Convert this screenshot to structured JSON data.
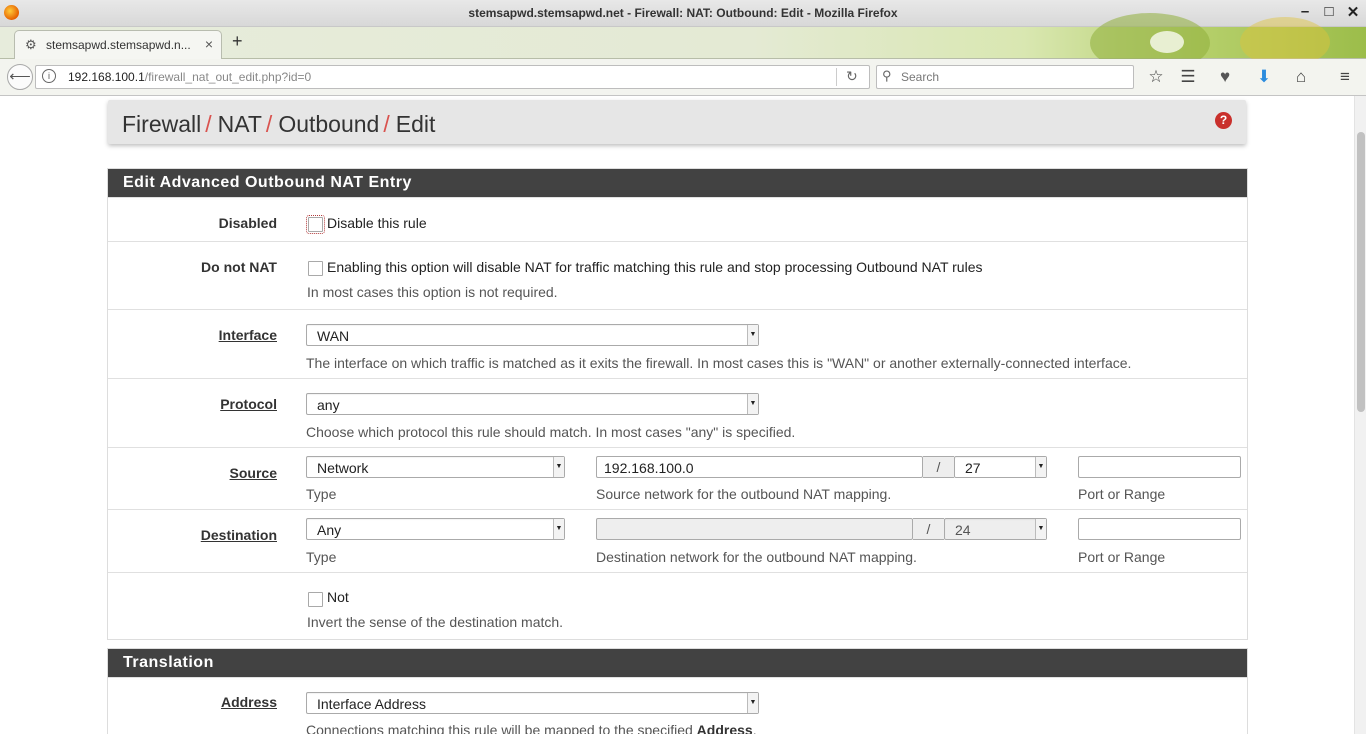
{
  "window": {
    "title": "stemsapwd.stemsapwd.net - Firewall: NAT: Outbound: Edit - Mozilla Firefox",
    "controls": {
      "minimize": "–",
      "maximize": "□",
      "close": "✕"
    }
  },
  "tabs": [
    {
      "label": "stemsapwd.stemsapwd.n...",
      "close": "×",
      "icon": "tab-favicon-icon"
    }
  ],
  "new_tab": "+",
  "nav": {
    "url_host": "192.168.100.1",
    "url_path": "/firewall_nat_out_edit.php?id=0",
    "search_placeholder": "Search",
    "icons": [
      "bookmark-star-icon",
      "reading-list-icon",
      "pocket-icon",
      "downloads-icon",
      "home-icon",
      "menu-icon"
    ]
  },
  "breadcrumb": {
    "items": [
      "Firewall",
      "NAT",
      "Outbound",
      "Edit"
    ],
    "separator": "/"
  },
  "panel1": {
    "title": "Edit Advanced Outbound NAT Entry",
    "disabled": {
      "label": "Disabled",
      "checkbox_label": "Disable this rule"
    },
    "donotnat": {
      "label": "Do not NAT",
      "checkbox_label": "Enabling this option will disable NAT for traffic matching this rule and stop processing Outbound NAT rules",
      "help": "In most cases this option is not required."
    },
    "interface": {
      "label": "Interface",
      "value": "WAN",
      "help": "The interface on which traffic is matched as it exits the firewall. In most cases this is \"WAN\" or another externally-connected interface."
    },
    "protocol": {
      "label": "Protocol",
      "value": "any",
      "help": "Choose which protocol this rule should match. In most cases \"any\" is specified."
    },
    "source": {
      "label": "Source",
      "type_value": "Network",
      "type_help": "Type",
      "network": "192.168.100.0",
      "slash": "/",
      "mask": "27",
      "network_help": "Source network for the outbound NAT mapping.",
      "port": "",
      "port_help": "Port or Range"
    },
    "destination": {
      "label": "Destination",
      "type_value": "Any",
      "type_help": "Type",
      "network": "",
      "slash": "/",
      "mask": "24",
      "network_help": "Destination network for the outbound NAT mapping.",
      "port": "",
      "port_help": "Port or Range"
    },
    "not": {
      "checkbox_label": "Not",
      "help": "Invert the sense of the destination match."
    }
  },
  "panel2": {
    "title": "Translation",
    "address": {
      "label": "Address",
      "value": "Interface Address",
      "help_prefix": "Connections matching this rule will be mapped to the specified ",
      "help_bold": "Address",
      "help_suffix": "."
    }
  },
  "colors": {
    "separator_red": "#d9534f",
    "panel_header": "#424242",
    "help_icon": "#c9302c"
  }
}
